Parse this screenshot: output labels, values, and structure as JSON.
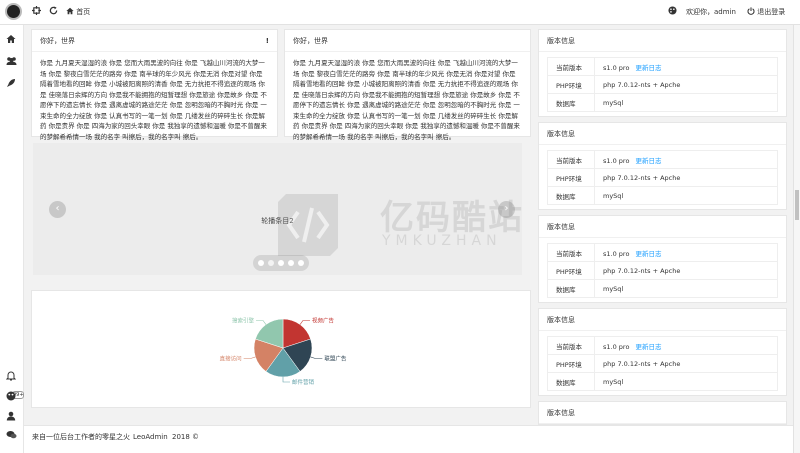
{
  "topbar": {
    "home_label": "首页",
    "welcome": "欢迎你，admin",
    "logout_label": "退出登录"
  },
  "sidebar": {
    "badge": "99+"
  },
  "cards": [
    {
      "title": "你好，世界",
      "body": "你是 九月夏天湿湿的浪 你是 您而大雨黑波的向往 你是 飞越山川河流的大梦一场 你是 黎夜白雪茫茫的路旁 你是 南半球的年少风光 你是无消 你是对望 你是 隔着雪地看的回眸 你是 小城被阳离照的清香 你是 无力抗拒不得追逐的观场 你是 佳晓落日余辉的方向 你是我不能拥抱的短暂理想 你是旅途 你是故乡 你是 不愿停下的遗忘情长 你是 遇离虚城的路途茫茫 你是 忽明忽暗的不胸时光 你是 一束生命的全力绽放 你是 认真书写的一笔一划 你是 几缕发丝的碎碎生长 你是解药 你是责界 你是 四海为家的回头幸眼 你是 我独享的遗憾和温暖 你是不曾醒来的梦解希希情一场 我的名字 叫擦后，我的名字叫 擦后。",
      "bang": "!"
    },
    {
      "title": "你好，世界",
      "body": "你是 九月夏天湿湿的浪 你是 您而大雨黑波的向往 你是 飞越山川河流的大梦一场 你是 黎夜白雪茫茫的路旁 你是 南半球的年少风光 你是无消 你是对望 你是 隔着雪地看的回眸 你是 小城被阳离照的清香 你是 无力抗拒不得追逐的观场 你是 佳晓落日余辉的方向 你是我不能拥抱的短暂理想 你是旅途 你是故乡 你是 不愿停下的遗忘情长 你是 遇离虚城的路途茫茫 你是 忽明忽暗的不胸时光 你是 一束生命的全力绽放 你是 认真书写的一笔一划 你是 几缕发丝的碎碎生长 你是解药 你是责界 你是 四海为家的回头幸眼 你是 我独享的遗憾和温暖 你是不曾醒来的梦解希希情一场 我的名字 叫擦后，我的名字叫 擦后。"
    }
  ],
  "carousel": {
    "slide_label": "轮播条目2",
    "prev": "‹",
    "next": "›",
    "dot_count": 5,
    "active_dot": 1
  },
  "chart_data": {
    "type": "pie",
    "categories": [
      "视频广告",
      "联盟广告",
      "邮件营销",
      "直接访问",
      "搜索引擎"
    ],
    "values": [
      20,
      20,
      20,
      20,
      20
    ],
    "colors": [
      "#c23531",
      "#2f4554",
      "#61a0a8",
      "#d48265",
      "#91c7ae"
    ],
    "legend": "none"
  },
  "info": {
    "title": "版本信息",
    "rows": [
      {
        "key": "当前版本",
        "value": "s1.0 pro",
        "link": "更新日志"
      },
      {
        "key": "PHP环境",
        "value": "php 7.0.12-nts + Apche"
      },
      {
        "key": "数据库",
        "value": "mySql"
      }
    ]
  },
  "footer": {
    "slogan": "来自一位后台工作者的零星之火",
    "brand": "LeoAdmin",
    "year": "2018 ©"
  },
  "watermark": {
    "brand": "亿码酷站",
    "sub": "YMKUZHAN"
  },
  "icons": {
    "logo": "logo-icon",
    "shrink": "shrink-icon",
    "refresh": "refresh-icon",
    "home": "home-icon",
    "theme": "theme-icon",
    "user": "user-icon",
    "power": "power-icon"
  }
}
